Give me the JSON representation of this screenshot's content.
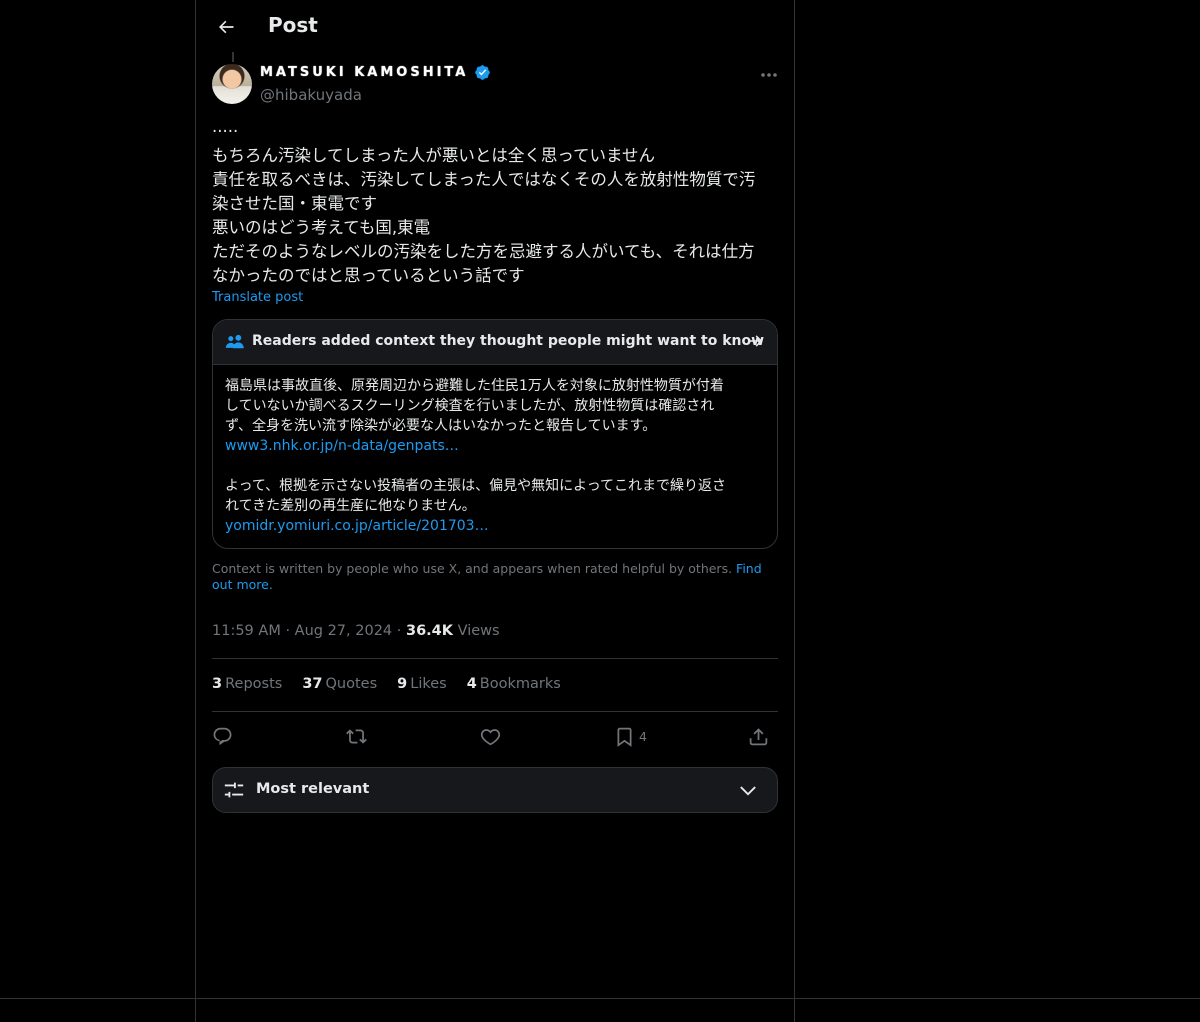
{
  "header": {
    "title": "Post",
    "back_icon": "arrow-left-icon"
  },
  "author": {
    "display_name": "MATSUKI KAMOSHITA",
    "handle": "@hibakuyada",
    "verified_icon": "verified-badge-icon",
    "more_icon": "more-horizontal-icon"
  },
  "post": {
    "lines": [
      "·····",
      "もちろん汚染してしまった人が悪いとは全く思っていません",
      "責任を取るべきは、汚染してしまった人ではなくその人を放射性物質で汚",
      "染させた国・東電です",
      "悪いのはどう考えても国,東電",
      "ただそのようなレベルの汚染をした方を忌避する人がいても、それは仕方",
      "なかったのではと思っているという話です"
    ],
    "translate": "Translate post"
  },
  "community_note": {
    "header": "Readers added context they thought people might want to know",
    "para1": [
      "福島県は事故直後、原発周辺から避難した住民1万人を対象に放射性物質が付着",
      "していないか調べるスクーリング検査を行いましたが、放射性物質は確認され",
      "ず、全身を洗い流す除染が必要な人はいなかったと報告しています。"
    ],
    "link1": "www3.nhk.or.jp/n-data/genpats…",
    "para2": [
      "よって、根拠を示さない投稿者の主張は、偏見や無知によってこれまで繰り返さ",
      "れてきた差別の再生産に他なりません。"
    ],
    "link2": "yomidr.yomiuri.co.jp/article/201703…",
    "footer": "Context is written by people who use X, and appears when rated helpful by others.",
    "find_out_more": "Find out more."
  },
  "meta": {
    "time": "11:59 AM",
    "sep": "·",
    "date": "Aug 27, 2024",
    "views_count": "36.4K",
    "views_label": "Views"
  },
  "stats": {
    "reposts": {
      "count": "3",
      "label": "Reposts"
    },
    "quotes": {
      "count": "37",
      "label": "Quotes"
    },
    "likes": {
      "count": "9",
      "label": "Likes"
    },
    "bookmarks": {
      "count": "4",
      "label": "Bookmarks"
    }
  },
  "actions": {
    "bookmark_count": "4"
  },
  "sort": {
    "label": "Most relevant"
  },
  "colors": {
    "background": "#000000",
    "accent": "#1d9bf0",
    "text": "#e7e9ea",
    "muted": "#71767b",
    "border": "#2f3336"
  }
}
